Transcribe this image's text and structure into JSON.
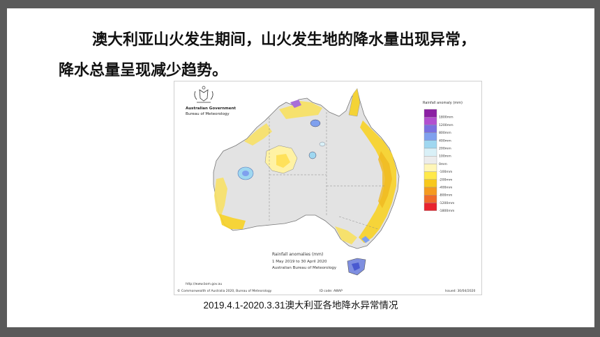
{
  "heading": {
    "line1": "澳大利亚山火发生期间，山火发生地的降水量出现异常，",
    "line2": "降水总量呈现减少趋势。"
  },
  "map": {
    "agency_line1": "Australian Government",
    "agency_line2": "Bureau of Meteorology",
    "legend_title": "Rainfall anomaly (mm)",
    "legend": [
      {
        "label": "1800mm",
        "color": "#8b1fa3"
      },
      {
        "label": "1200mm",
        "color": "#b24fd0"
      },
      {
        "label": "800mm",
        "color": "#7b6fe0"
      },
      {
        "label": "400mm",
        "color": "#7fa0ee"
      },
      {
        "label": "200mm",
        "color": "#9fd7f0"
      },
      {
        "label": "100mm",
        "color": "#d9f0f7"
      },
      {
        "label": "0mm",
        "color": "#ececec"
      },
      {
        "label": "-100mm",
        "color": "#fff6b8"
      },
      {
        "label": "-200mm",
        "color": "#ffe94a"
      },
      {
        "label": "-400mm",
        "color": "#f8c81c"
      },
      {
        "label": "-800mm",
        "color": "#f59a20"
      },
      {
        "label": "-1200mm",
        "color": "#f06a2a"
      },
      {
        "label": "-1800mm",
        "color": "#e8232e"
      }
    ],
    "inset_title": "Rainfall anomalies (mm)",
    "inset_period": "1 May 2019 to 30 April 2020",
    "inset_source": "Australian Bureau of Meteorology",
    "url": "http://www.bom.gov.au",
    "copyright": "© Commonwealth of Australia 2020, Bureau of Meteorology",
    "id_code": "ID code: AWAP",
    "issued": "Issued: 30/04/2020"
  },
  "caption_date": "2019.4.1-2020.3.31",
  "caption_text": "澳大利亚各地降水异常情况"
}
